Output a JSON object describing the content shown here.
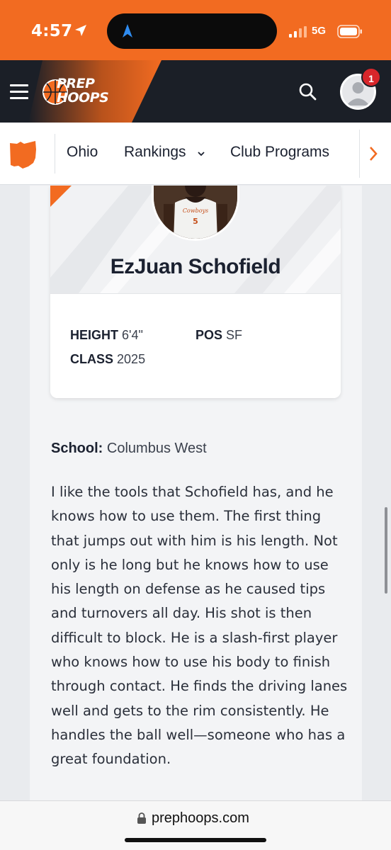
{
  "status_bar": {
    "time": "4:57",
    "network": "5G",
    "icons": [
      "location-arrow-icon",
      "navigation-arrow-icon",
      "signal-icon",
      "battery-icon"
    ]
  },
  "header": {
    "logo_line1": "PREP",
    "logo_line2": "HOOPS",
    "notification_count": "1",
    "icons": [
      "menu-icon",
      "search-icon",
      "avatar-icon"
    ],
    "colors": {
      "brand_orange": "#f26b21",
      "header_dark": "#1b1f27",
      "badge_red": "#d8262b"
    }
  },
  "subnav": {
    "state_icon": "ohio-state-icon",
    "items": [
      {
        "label": "Ohio"
      },
      {
        "label": "Rankings"
      },
      {
        "label": "Club Programs"
      }
    ]
  },
  "profile": {
    "name": "EzJuan Schofield",
    "jersey_text": "Cowboys",
    "jersey_number": "5",
    "stats": {
      "height_label": "HEIGHT",
      "height_value": "6'4\"",
      "pos_label": "POS",
      "pos_value": "SF",
      "class_label": "CLASS",
      "class_value": "2025"
    }
  },
  "article": {
    "school_label": "School:",
    "school_value": "Columbus West",
    "paragraph": "I like the tools that Schofield has, and he knows how to use them. The first thing that jumps out with him is his length. Not only is he long but he knows how to use his length on defense as he caused tips and turnovers all day. His shot is then difficult to block. He is a slash-first player who knows how to use his body to finish through contact. He finds the driving lanes well and gets to the rim consistently. He handles the ball well—someone who has a great foundation."
  },
  "url_bar": {
    "domain": "prephoops.com"
  }
}
